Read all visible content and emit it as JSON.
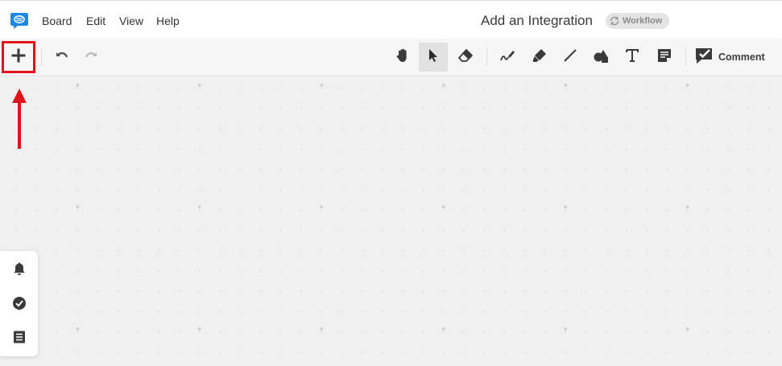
{
  "app": {
    "logo_icon": "chat-bubble-logo-icon",
    "brand_color": "#1e88e5"
  },
  "menu": {
    "items": [
      {
        "label": "Board"
      },
      {
        "label": "Edit"
      },
      {
        "label": "View"
      },
      {
        "label": "Help"
      }
    ]
  },
  "document": {
    "title": "Add an Integration",
    "badge_label": "Workflow",
    "badge_icon": "workflow-cycle-icon"
  },
  "toolbar": {
    "add_icon": "plus-icon",
    "undo_icon": "undo-icon",
    "redo_icon": "redo-icon",
    "tools": [
      {
        "icon": "hand-pan-icon"
      },
      {
        "icon": "select-cursor-icon",
        "active": true
      },
      {
        "icon": "eraser-icon"
      },
      {
        "icon": "freehand-pen-icon"
      },
      {
        "icon": "highlighter-icon"
      },
      {
        "icon": "line-icon"
      },
      {
        "icon": "shapes-icon"
      },
      {
        "icon": "text-icon",
        "glyph": "T"
      },
      {
        "icon": "sticky-note-icon"
      }
    ],
    "comment_label": "Comment",
    "comment_icon": "comment-check-icon"
  },
  "annotation": {
    "highlight_color": "#e0151b"
  },
  "side_panel": {
    "items": [
      {
        "icon": "bell-icon"
      },
      {
        "icon": "check-circle-icon"
      },
      {
        "icon": "list-icon"
      }
    ]
  }
}
